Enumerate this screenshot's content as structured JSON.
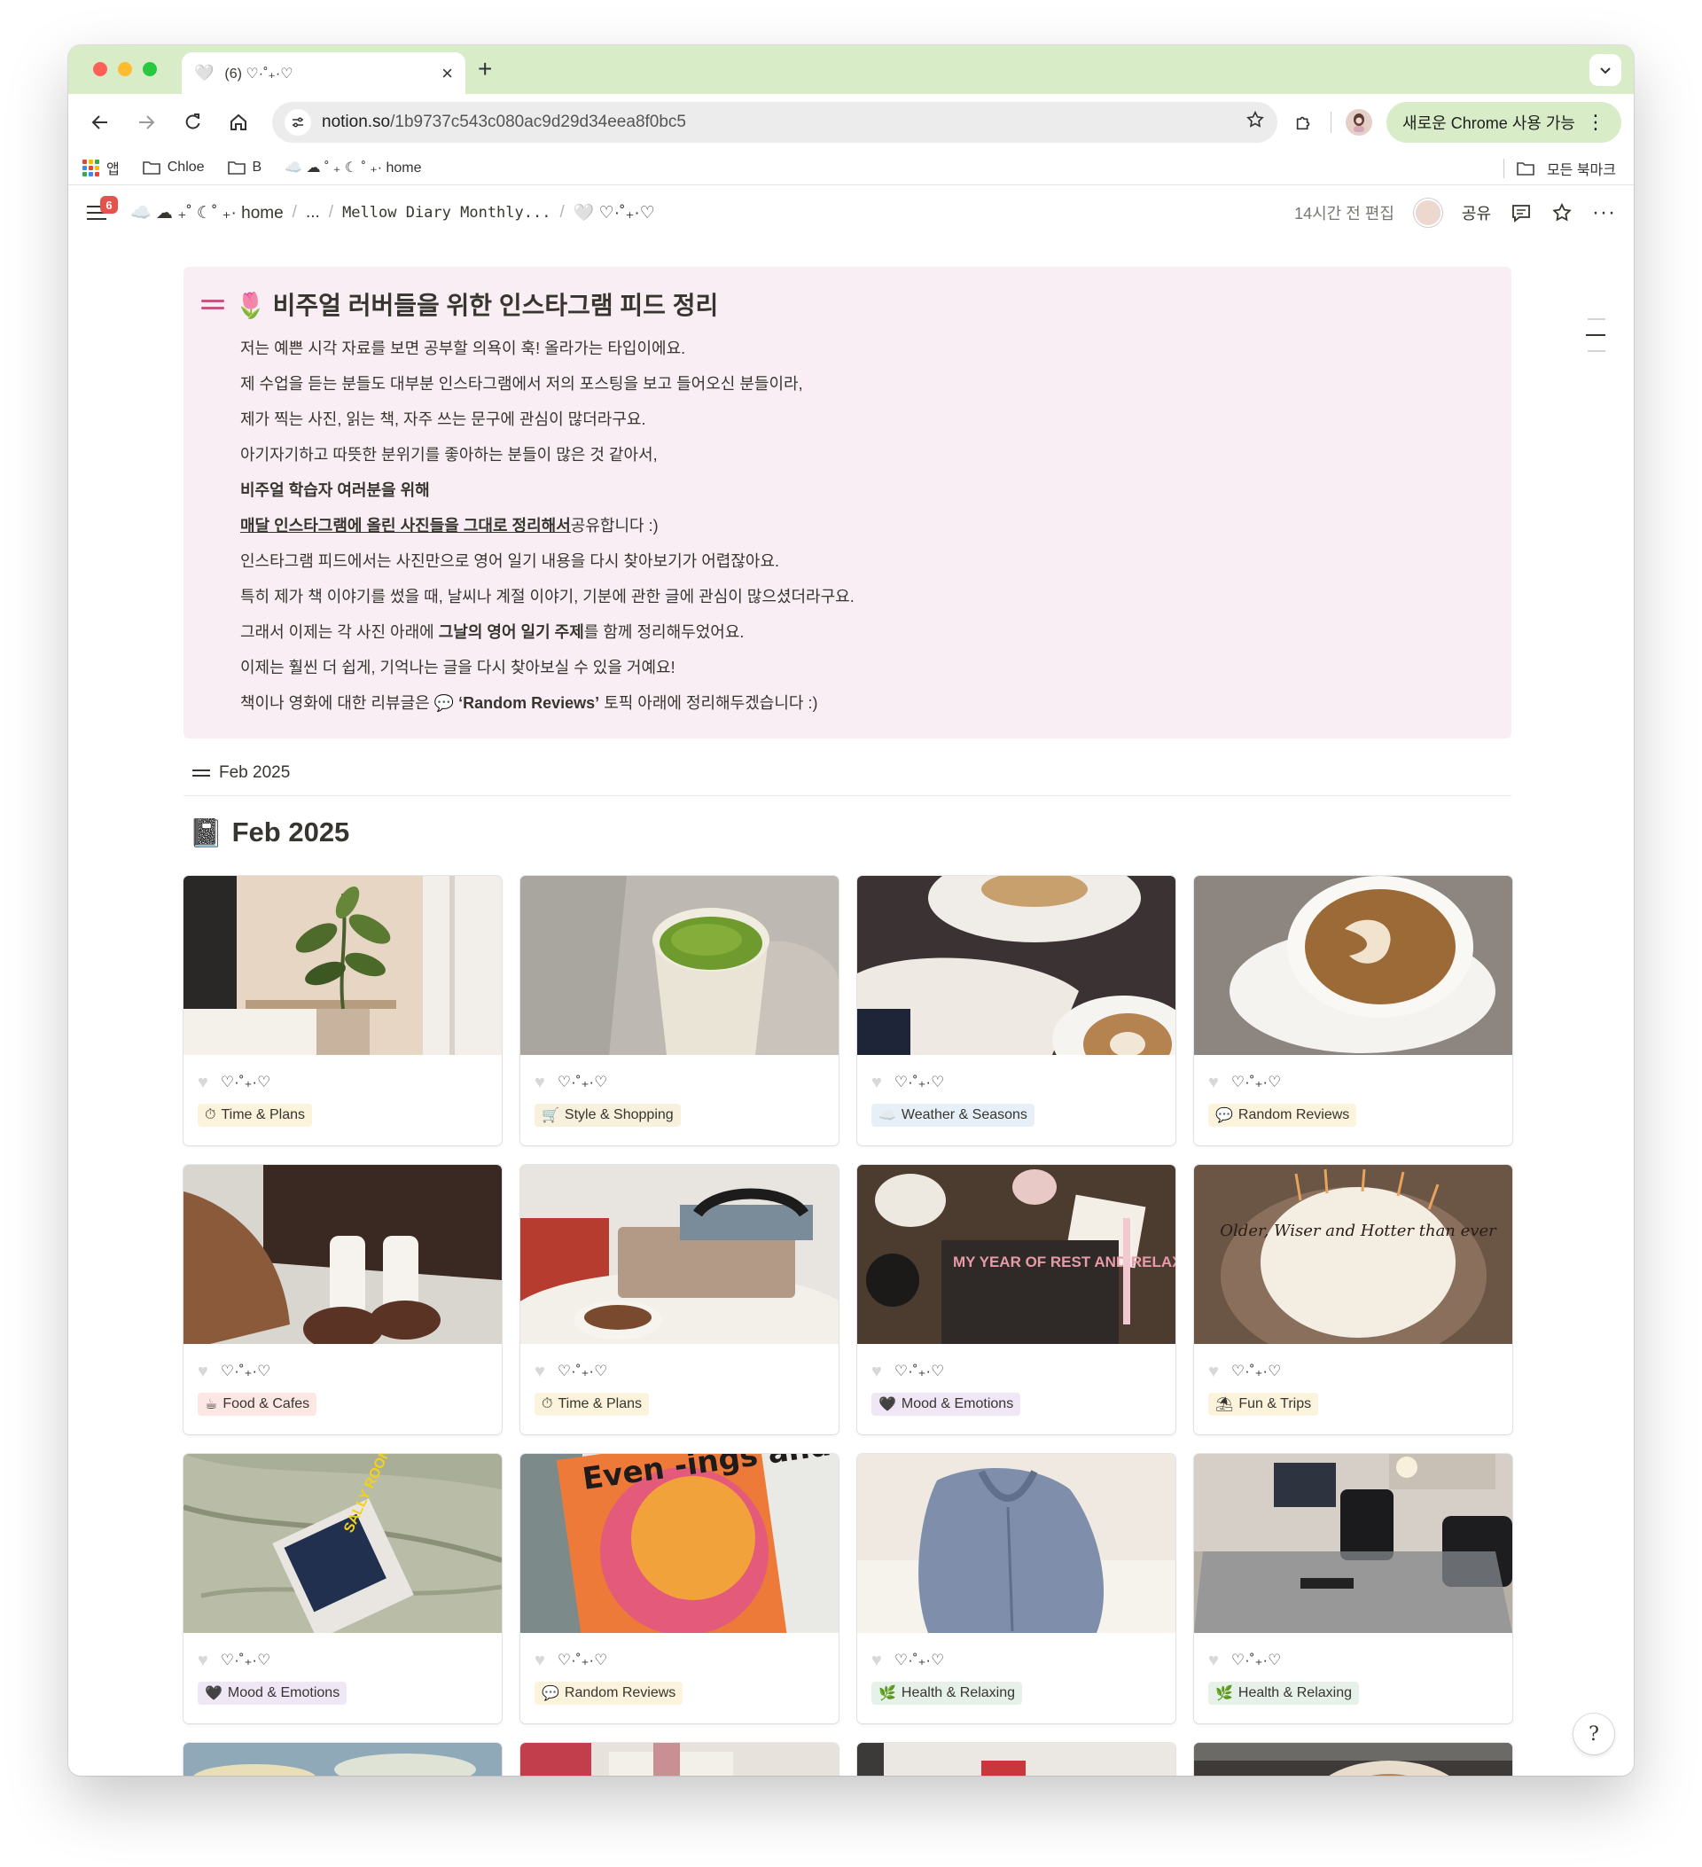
{
  "browser": {
    "tab": {
      "title": "(6) ♡·˚₊·♡",
      "favicon": "🤍"
    },
    "url_domain": "notion.so",
    "url_path": "/1b9737c543c080ac9d29d34eea8f0bc5",
    "chrome_pill": "새로운 Chrome 사용 가능",
    "bookmarks": [
      {
        "label": "앱",
        "icon": "apps-grid-icon"
      },
      {
        "label": "Chloe",
        "icon": "folder-icon"
      },
      {
        "label": "B",
        "icon": "folder-icon"
      },
      {
        "label": "☁️ ☁ ˚ ₊ ☾ ˚ ₊· home",
        "icon": "page-icon"
      }
    ],
    "bookmarks_right": "모든 북마크"
  },
  "notion": {
    "badge": "6",
    "breadcrumbs": [
      "☁️ ☁ ₊˚ ☾˚ ₊· home",
      "...",
      "Mellow Diary Monthly...",
      "🤍 ♡·˚₊·♡"
    ],
    "edited": "14시간 전 편집",
    "share": "공유",
    "callout": {
      "title": "🌷 비주얼 러버들을 위한 인스타그램 피드 정리",
      "lines": [
        "저는 예쁜 시각 자료를 보면 공부할 의욕이 훅! 올라가는 타입이에요.",
        "제 수업을 듣는 분들도 대부분 인스타그램에서 저의 포스팅을 보고 들어오신 분들이라,",
        "제가 찍는 사진, 읽는 책, 자주 쓰는 문구에 관심이 많더라구요.",
        "아기자기하고 따뜻한 분위기를 좋아하는 분들이 많은 것 같아서,",
        "비주얼 학습자 여러분을 위해",
        "매달 인스타그램에 올린 사진들을 그대로 정리해서",
        "공유합니다 :)",
        "인스타그램 피드에서는 사진만으로 영어 일기 내용을 다시 찾아보기가 어렵잖아요.",
        "특히 제가 책 이야기를 썼을 때, 날씨나 계절 이야기, 기분에 관한 글에 관심이 많으셨더라구요.",
        "그래서 이제는 각 사진 아래에 ",
        "그날의 영어 일기 주제",
        "를 함께 정리해두었어요.",
        "이제는 훨씬 더 쉽게, 기억나는 글을 다시 찾아보실 수 있을 거예요!",
        "책이나 영화에 대한 리뷰글은 💬 ",
        "‘Random Reviews’",
        " 토픽 아래에 정리해두겠습니다 :)"
      ]
    },
    "toggle_label": "Feb 2025",
    "heading": "Feb 2025",
    "heading_icon": "📓",
    "card_title": "♡·˚₊·♡",
    "cards": [
      {
        "tag": "Time & Plans",
        "emoji": "⏱",
        "tag_bg": "#fbf3db"
      },
      {
        "tag": "Style & Shopping",
        "emoji": "🛒",
        "tag_bg": "#f6f0dc"
      },
      {
        "tag": "Weather & Seasons",
        "emoji": "☁️",
        "tag_bg": "#e7f0f8"
      },
      {
        "tag": "Random Reviews",
        "emoji": "💬",
        "tag_bg": "#fbf3db"
      },
      {
        "tag": "Food & Cafes",
        "emoji": "☕",
        "tag_bg": "#fde7e4"
      },
      {
        "tag": "Time & Plans",
        "emoji": "⏱",
        "tag_bg": "#fbf3db"
      },
      {
        "tag": "Mood & Emotions",
        "emoji": "🖤",
        "tag_bg": "#efe6f6"
      },
      {
        "tag": "Fun & Trips",
        "emoji": "⛱",
        "tag_bg": "#fbf3db"
      },
      {
        "tag": "Mood & Emotions",
        "emoji": "🖤",
        "tag_bg": "#efe6f6"
      },
      {
        "tag": "Random Reviews",
        "emoji": "💬",
        "tag_bg": "#fbf3db"
      },
      {
        "tag": "Health & Relaxing",
        "emoji": "🌿",
        "tag_bg": "#e6f2e9"
      },
      {
        "tag": "Health & Relaxing",
        "emoji": "🌿",
        "tag_bg": "#e6f2e9"
      }
    ],
    "photo_texts": {
      "book_cover": "MY YEAR OF REST AND RELAXATION",
      "cake": "Older, Wiser and Hotter than ever",
      "evenings": "Even -ings and Week ends",
      "sally": "SALLY ROONEY"
    }
  }
}
